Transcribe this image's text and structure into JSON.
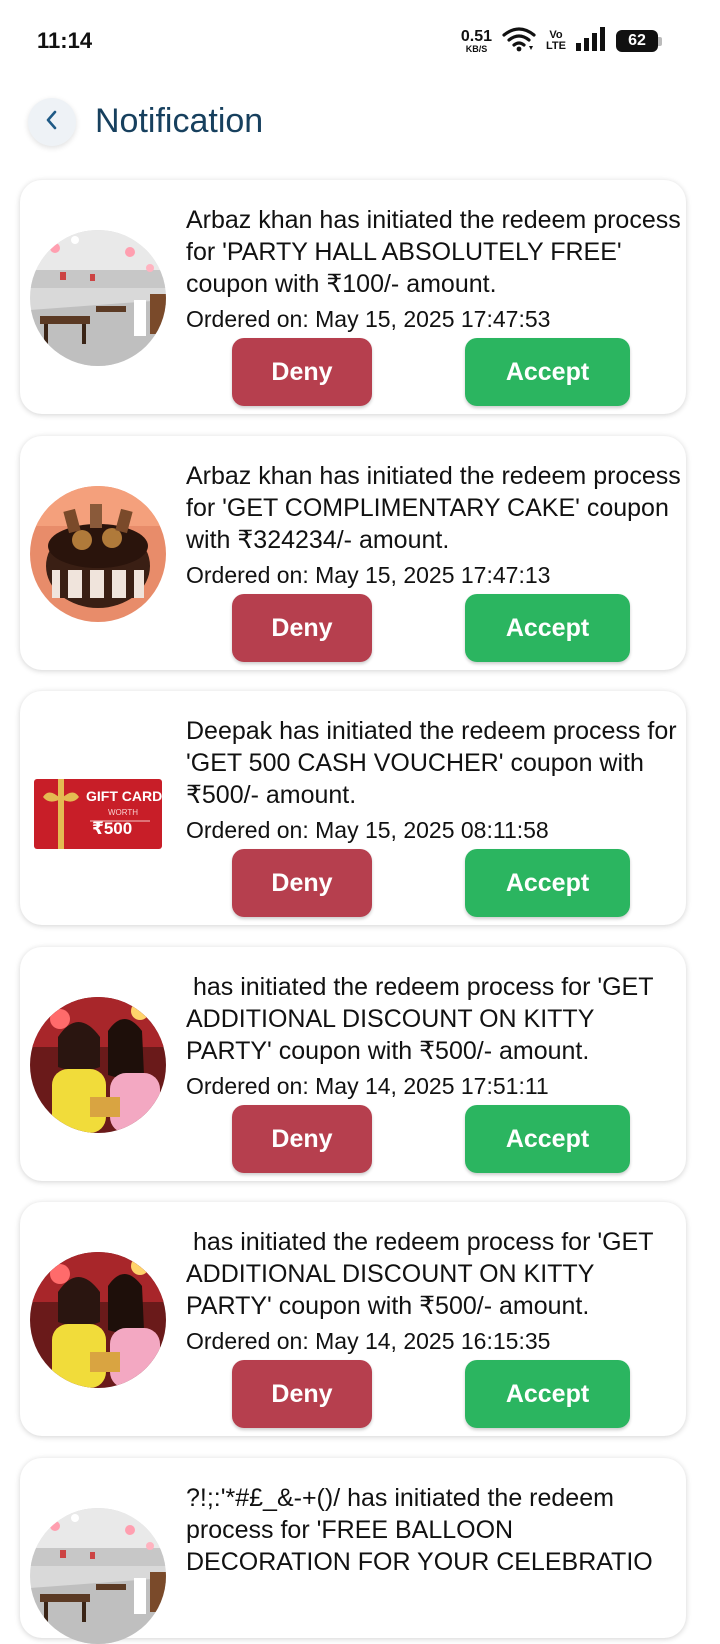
{
  "status_bar": {
    "time": "11:14",
    "net_speed": "0.51",
    "net_unit": "KB/S",
    "volte_top": "Vo",
    "volte_bottom": "LTE",
    "battery": "62"
  },
  "header": {
    "title": "Notification",
    "back_icon": "chevron-left-icon"
  },
  "colors": {
    "deny": "#b63f4e",
    "accept": "#2bb560",
    "title": "#17405e"
  },
  "notifications": [
    {
      "image": "party-hall-photo",
      "message": "Arbaz khan has initiated the redeem process for 'PARTY HALL ABSOLUTELY FREE' coupon with ₹100/- amount.",
      "ordered": "Ordered on: May 15, 2025 17:47:53",
      "deny_label": "Deny",
      "accept_label": "Accept"
    },
    {
      "image": "cake-photo",
      "message": "Arbaz khan has initiated the redeem process for 'GET COMPLIMENTARY CAKE' coupon with ₹324234/- amount.",
      "ordered": "Ordered on: May 15, 2025 17:47:13",
      "deny_label": "Deny",
      "accept_label": "Accept"
    },
    {
      "image": "gift-card-image",
      "gift_card_title": "GIFT CARD",
      "gift_card_worth": "WORTH",
      "gift_card_amount": "₹500",
      "message": "Deepak has initiated the redeem process for 'GET 500  CASH VOUCHER' coupon with ₹500/- amount.",
      "ordered": "Ordered on: May 15, 2025 08:11:58",
      "deny_label": "Deny",
      "accept_label": "Accept"
    },
    {
      "image": "kitty-party-photo",
      "message": " has initiated the redeem process for 'GET  ADDITIONAL DISCOUNT ON KITTY PARTY' coupon with ₹500/- amount.",
      "ordered": "Ordered on: May 14, 2025 17:51:11",
      "deny_label": "Deny",
      "accept_label": "Accept"
    },
    {
      "image": "kitty-party-photo",
      "message": " has initiated the redeem process for 'GET  ADDITIONAL DISCOUNT ON KITTY PARTY' coupon with ₹500/- amount.",
      "ordered": "Ordered on: May 14, 2025 16:15:35",
      "deny_label": "Deny",
      "accept_label": "Accept"
    },
    {
      "image": "party-hall-photo",
      "message": "?!;:'*#£_&-+()/ has initiated the redeem process for 'FREE BALLOON DECORATION FOR YOUR CELEBRATIO"
    }
  ]
}
